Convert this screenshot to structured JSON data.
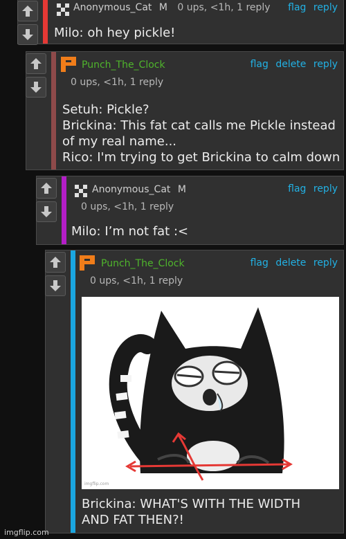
{
  "comments": [
    {
      "username": "Anonymous_Cat",
      "gender": "M",
      "meta": "0 ups, <1h, 1 reply",
      "actions": [
        "flag",
        "reply"
      ],
      "text": "Milo: oh hey pickle!",
      "bar_color": "#e53935"
    },
    {
      "username": "Punch_The_Clock",
      "meta": "0 ups, <1h, 1 reply",
      "actions": [
        "flag",
        "delete",
        "reply"
      ],
      "text": "Setuh: Pickle?\nBrickina: This fat cat calls me Pickle instead\nof my real name...\nRico: I'm trying to get Brickina to calm down",
      "bar_color": "#8e4a4a"
    },
    {
      "username": "Anonymous_Cat",
      "gender": "M",
      "meta": "0 ups, <1h, 1 reply",
      "actions": [
        "flag",
        "reply"
      ],
      "text": "Milo: I’m not fat :<",
      "bar_color": "#b41ec8"
    },
    {
      "username": "Punch_The_Clock",
      "meta": "0 ups, <1h, 1 reply",
      "actions": [
        "flag",
        "delete",
        "reply"
      ],
      "text": "Brickina: WHAT'S WITH THE WIDTH\nAND FAT THEN?!",
      "bar_color": "#1aa6e0",
      "image_watermark": "imgflip.com"
    }
  ],
  "watermark": "imgflip.com",
  "icons": {
    "upvote": "arrow-up-icon",
    "downvote": "arrow-down-icon",
    "anon_avatar": "pixel-avatar-icon",
    "punch_avatar": "p-logo-icon"
  },
  "colors": {
    "link": "#22b1e4",
    "punch_user": "#4fb52c",
    "punch_logo": "#f07d1a"
  }
}
